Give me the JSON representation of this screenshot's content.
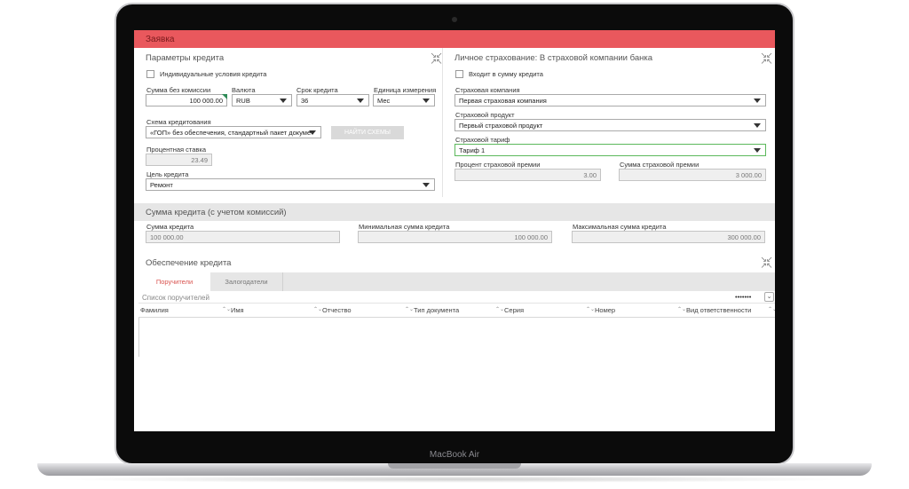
{
  "device": {
    "label": "MacBook Air"
  },
  "app": {
    "title": "Заявка"
  },
  "credit_params": {
    "title": "Параметры кредита",
    "individual_conditions_label": "Индивидуальные условия кредита",
    "amount_label": "Сумма без комиссии",
    "amount_value": "100 000.00",
    "currency_label": "Валюта",
    "currency_value": "RUB",
    "term_label": "Срок кредита",
    "term_value": "36",
    "unit_label": "Единица измерения",
    "unit_value": "Мес",
    "scheme_label": "Схема кредитования",
    "scheme_value": "«ГОП» без обеспечения, стандартный пакет докуме",
    "find_schemes_button": "НАЙТИ СХЕМЫ",
    "rate_label": "Процентная ставка",
    "rate_value": "23.49",
    "purpose_label": "Цель кредита",
    "purpose_value": "Ремонт"
  },
  "insurance": {
    "title": "Личное страхование: В страховой компании банка",
    "include_label": "Входит в сумму кредита",
    "company_label": "Страховая компания",
    "company_value": "Первая страховая компания",
    "product_label": "Страховой продукт",
    "product_value": "Первый страховой продукт",
    "tariff_label": "Страховой тариф",
    "tariff_value": "Тариф 1",
    "premium_pct_label": "Процент страховой премии",
    "premium_pct_value": "3.00",
    "premium_sum_label": "Сумма страховой премии",
    "premium_sum_value": "3 000.00"
  },
  "credit_sum": {
    "title": "Сумма кредита (с учетом комиссий)",
    "sum_label": "Сумма кредита",
    "sum_value": "100 000.00",
    "min_label": "Минимальная сумма кредита",
    "min_value": "100 000.00",
    "max_label": "Максимальная сумма кредита",
    "max_value": "300 000.00"
  },
  "collateral": {
    "title": "Обеспечение кредита",
    "tabs": [
      "Поручители",
      "Залогодатели"
    ],
    "list_title": "Список поручителей",
    "more": "•••••••",
    "columns": [
      "Фамилия",
      "Имя",
      "Отчество",
      "Тип документа",
      "Серия",
      "Номер",
      "Вид ответственности"
    ]
  },
  "colors": {
    "accent": "#e9585d",
    "active_tab_text": "#d9534f",
    "focus_border": "#5cb85c"
  }
}
